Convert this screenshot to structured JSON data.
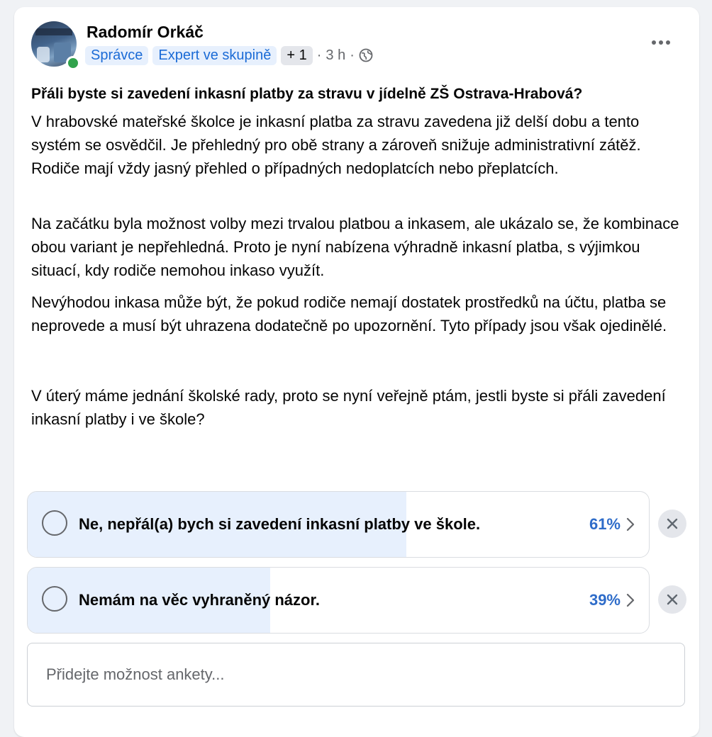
{
  "post": {
    "author": "Radomír Orkáč",
    "badges": [
      "Správce",
      "Expert ve skupině"
    ],
    "extra_badge": "+ 1",
    "separator": "·",
    "time": "3 h",
    "privacy_icon": "globe-icon",
    "more_icon": "more-options-icon",
    "title": "Přáli byste si zavedení inkasní platby za stravu v jídelně ZŠ Ostrava-Hrabová?",
    "paragraphs": [
      "V hrabovské mateřské školce je inkasní platba za stravu zavedena již delší dobu a tento systém se osvědčil. Je přehledný pro obě strany a zároveň snižuje administrativní zátěž. Rodiče mají vždy jasný přehled o případných nedoplatcích nebo přeplatcích.",
      "Na začátku byla možnost volby mezi trvalou platbou a inkasem, ale ukázalo se, že kombinace obou variant je nepřehledná. Proto je nyní nabízena výhradně inkasní platba, s výjimkou situací, kdy rodiče nemohou inkaso využít.",
      "Nevýhodou inkasa může být, že pokud rodiče nemají dostatek prostředků na účtu, platba se neprovede a musí být uhrazena dodatečně po upozornění. Tyto případy jsou však ojedinělé.",
      "V úterý máme jednání školské rady, proto se nyní veřejně ptám, jestli byste si přáli zavedení inkasní platby i ve škole?"
    ]
  },
  "poll": {
    "options": [
      {
        "label": "Ne, nepřál(a) bych si zavedení inkasní platby ve škole.",
        "percent": 61,
        "percent_text": "61%"
      },
      {
        "label": "Nemám na věc vyhraněný názor.",
        "percent": 39,
        "percent_text": "39%"
      }
    ],
    "add_option_placeholder": "Přidejte možnost ankety..."
  },
  "colors": {
    "accent": "#1b6bd6",
    "percent_text": "#2e6cc9",
    "bar_fill": "#e7f0fd",
    "online": "#31a24c"
  }
}
